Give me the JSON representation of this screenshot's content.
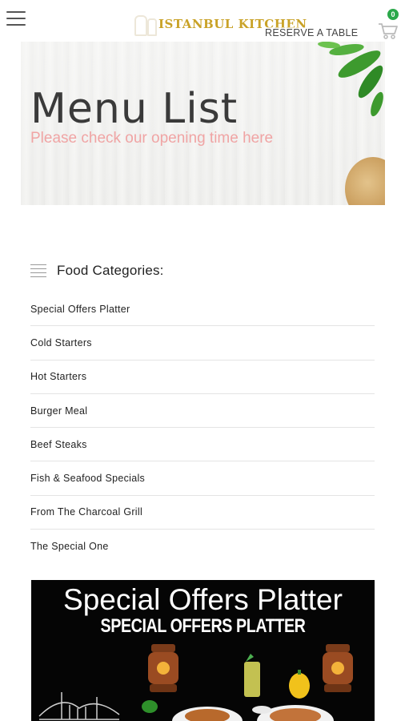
{
  "header": {
    "logo_text": "ISTANBUL KITCHEN",
    "reserve_label": "RESERVE A TABLE",
    "cart_count": "0"
  },
  "hero": {
    "title": "Menu List",
    "subtitle": "Please check our opening time here"
  },
  "categories": {
    "heading": "Food Categories:",
    "items": [
      {
        "label": "Special Offers Platter"
      },
      {
        "label": "Cold Starters"
      },
      {
        "label": "Hot Starters"
      },
      {
        "label": "Burger Meal"
      },
      {
        "label": "Beef Steaks"
      },
      {
        "label": "Fish & Seafood Specials"
      },
      {
        "label": "From The Charcoal Grill"
      },
      {
        "label": "The Special One"
      }
    ]
  },
  "banner": {
    "title": "Special Offers Platter",
    "subtitle": "SPECIAL OFFERS PLATTER"
  },
  "colors": {
    "brand_gold": "#c9a227",
    "subtitle_pink": "#f0a4a4",
    "badge_green": "#2ba84a"
  },
  "icons": [
    "menu-icon",
    "logo-icon",
    "cart-icon",
    "list-icon"
  ]
}
